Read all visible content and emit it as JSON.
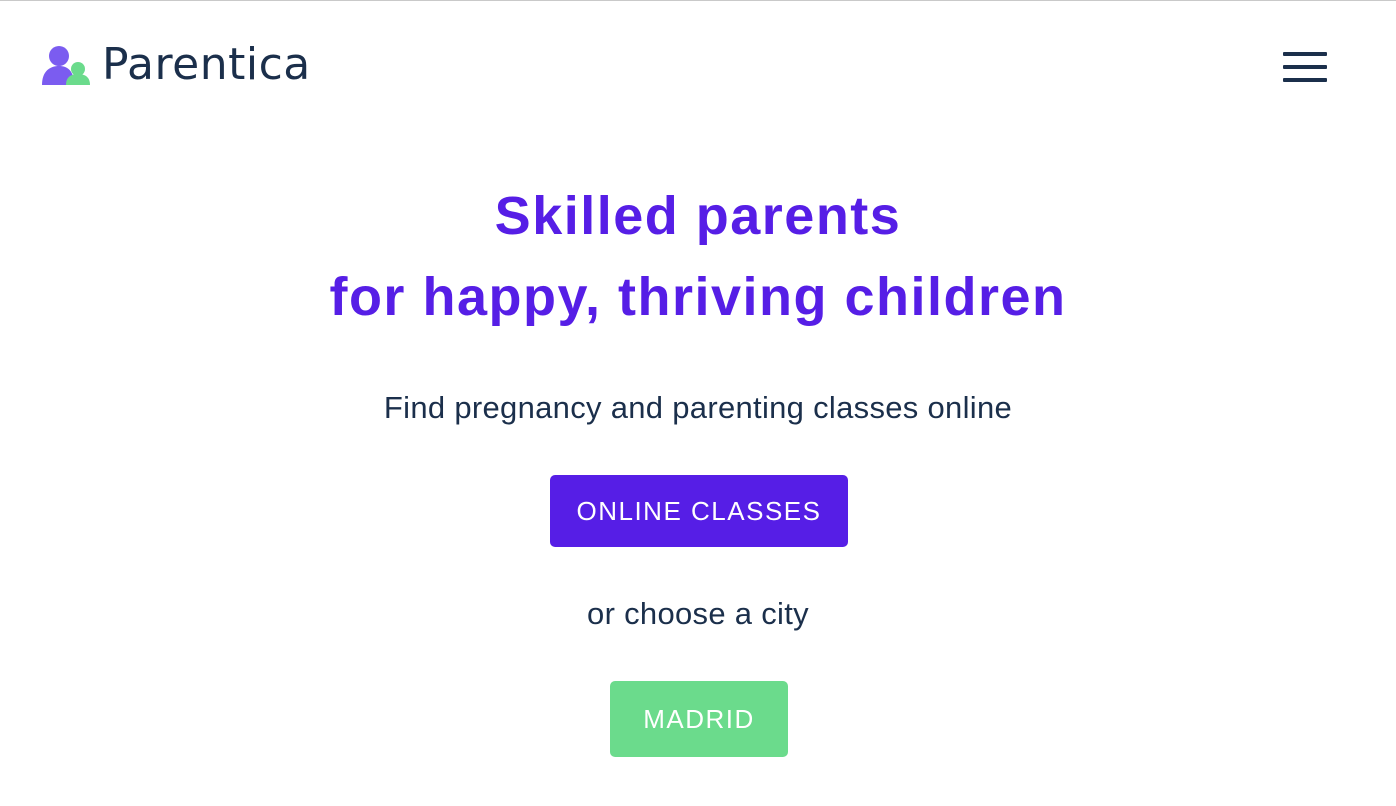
{
  "header": {
    "brand_name": "Parentica",
    "logo_icon": "parents-icon",
    "menu_icon": "hamburger-menu-icon"
  },
  "hero": {
    "headline_line1": "Skilled parents",
    "headline_line2": "for happy, thriving children",
    "subline": "Find pregnancy and parenting classes online",
    "online_button_label": "ONLINE CLASSES",
    "choose_text": "or choose a city",
    "city_button_label": "MADRID"
  },
  "colors": {
    "brand_purple": "#561ee6",
    "brand_green": "#6bdb8c",
    "text_dark": "#1b2f4b",
    "logo_person_purple": "#7b5cf0",
    "logo_person_green": "#6bdb8c"
  }
}
